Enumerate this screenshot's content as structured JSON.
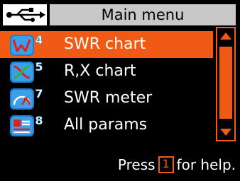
{
  "header": {
    "title": "Main menu",
    "usb_icon": "usb-icon"
  },
  "menu": {
    "items": [
      {
        "label": "SWR chart",
        "badge": "4",
        "icon": "swr-chart-icon",
        "selected": true
      },
      {
        "label": "R,X chart",
        "badge": "5",
        "icon": "rx-chart-icon",
        "selected": false
      },
      {
        "label": "SWR meter",
        "badge": "7",
        "icon": "swr-meter-icon",
        "selected": false
      },
      {
        "label": "All params",
        "badge": "8",
        "icon": "all-params-icon",
        "selected": false
      }
    ]
  },
  "footer": {
    "before": "Press",
    "key": "1",
    "after": "for help."
  },
  "colors": {
    "accent": "#f05a14",
    "title_bg": "#c8c8c8",
    "background": "#000000",
    "icon_blue": "#1e7fd0"
  }
}
